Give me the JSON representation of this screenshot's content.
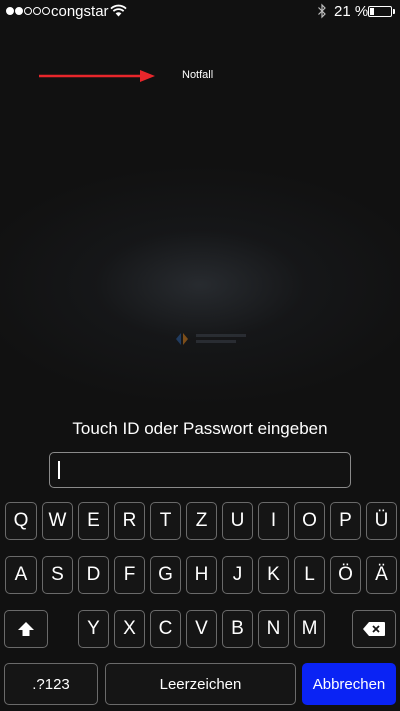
{
  "status_bar": {
    "signal_dots_filled": 2,
    "signal_dots_total": 5,
    "carrier": "congstar",
    "wifi_icon": "wifi-icon",
    "bluetooth_icon": "bluetooth-icon",
    "battery_percent": "21 %",
    "battery_level": 0.21
  },
  "emergency": {
    "label": "Notfall",
    "arrow_color": "#e8262b"
  },
  "lock": {
    "prompt": "Touch ID oder Passwort eingeben",
    "field_value": ""
  },
  "keyboard": {
    "row1": [
      "Q",
      "W",
      "E",
      "R",
      "T",
      "Z",
      "U",
      "I",
      "O",
      "P",
      "Ü"
    ],
    "row2": [
      "A",
      "S",
      "D",
      "F",
      "G",
      "H",
      "J",
      "K",
      "L",
      "Ö",
      "Ä"
    ],
    "row3": [
      "Y",
      "X",
      "C",
      "V",
      "B",
      "N",
      "M"
    ],
    "shift_icon": "shift-icon",
    "delete_icon": "delete-icon",
    "numbers_label": ".?123",
    "space_label": "Leerzeichen",
    "cancel_label": "Abbrechen",
    "cancel_color": "#0a23f4"
  }
}
